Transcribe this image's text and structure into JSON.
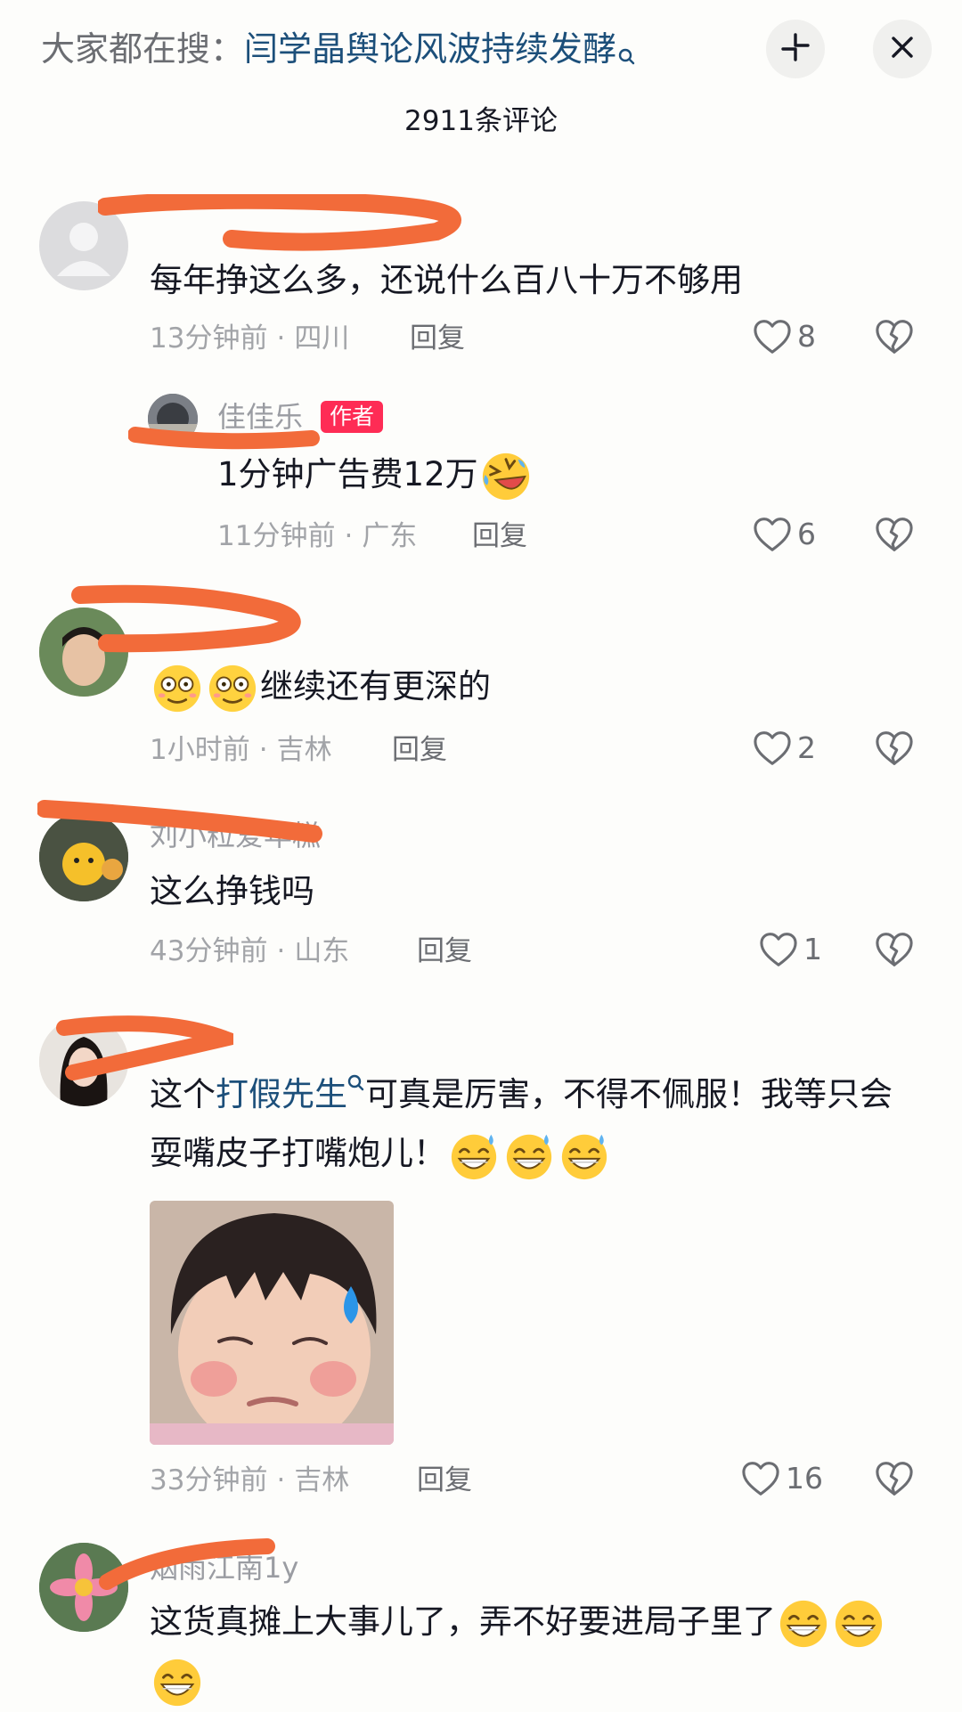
{
  "header": {
    "search_prefix": "大家都在搜：",
    "search_query": "闫学晶舆论风波持续发酵",
    "comment_count": "2911条评论"
  },
  "comments": [
    {
      "username": "",
      "text": "每年挣这么多，还说什么百八十万不够用",
      "time": "13分钟前",
      "location": "四川",
      "reply_label": "回复",
      "likes": "8"
    },
    {
      "username": "佳佳乐",
      "badge": "作者",
      "text": "1分钟广告费12万",
      "time": "11分钟前",
      "location": "广东",
      "reply_label": "回复",
      "likes": "6"
    },
    {
      "username": "",
      "text": "继续还有更深的",
      "time": "1小时前",
      "location": "吉林",
      "reply_label": "回复",
      "likes": "2"
    },
    {
      "username": "刘小粒爱年糕",
      "text": "这么挣钱吗",
      "time": "43分钟前",
      "location": "山东",
      "reply_label": "回复",
      "likes": "1"
    },
    {
      "username": "",
      "text_a": "这个",
      "text_link": "打假先生",
      "text_b": "可真是厉害，不得不佩服！我等只会耍嘴皮子打嘴炮儿！",
      "time": "33分钟前",
      "location": "吉林",
      "reply_label": "回复",
      "likes": "16"
    },
    {
      "username": "烟雨江南1y",
      "text": "这货真摊上大事儿了，弄不好要进局子里了"
    }
  ],
  "icons": {
    "minimize": "collapse-icon",
    "close": "close-icon",
    "like": "heart-outline-icon",
    "dislike": "broken-heart-icon",
    "search": "search-icon"
  },
  "colors": {
    "link": "#1c4f7a",
    "author_badge": "#fe2c55",
    "meta": "#a2a4a8",
    "background": "#fdfdfb"
  }
}
